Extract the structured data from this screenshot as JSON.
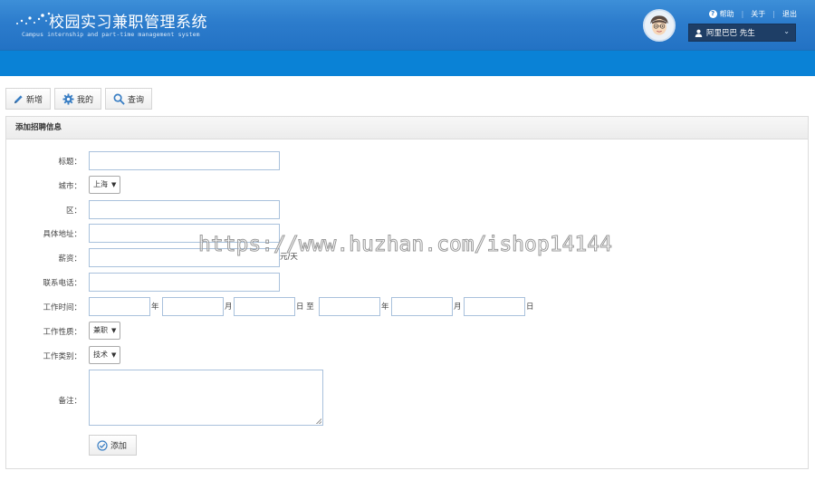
{
  "header": {
    "title": "校园实习兼职管理系统",
    "subtitle": "Campus internship and part-time management system",
    "links": {
      "help": "帮助",
      "about": "关于",
      "logout": "退出"
    },
    "user": "阿里巴巴 先生",
    "user_dropdown_icon": "chevron-down-icon"
  },
  "toolbar": {
    "new_label": "新增",
    "mine_label": "我的",
    "query_label": "查询"
  },
  "panel": {
    "title": "添加招聘信息"
  },
  "form": {
    "title_label": "标题：",
    "city_label": "城市：",
    "city_value": "上海",
    "district_label": "区：",
    "address_label": "具体地址：",
    "salary_label": "薪资：",
    "salary_unit": "元/天",
    "phone_label": "联系电话：",
    "worktime_label": "工作时间：",
    "year": "年",
    "month": "月",
    "day_to": "日 至",
    "day": "日",
    "nature_label": "工作性质：",
    "nature_value": "兼职",
    "category_label": "工作类别：",
    "category_value": "技术",
    "remark_label": "备注：",
    "submit_label": "添加"
  },
  "watermark": "https://www.huzhan.com/ishop14144",
  "colors": {
    "header_blue": "#2c7ccc",
    "nav_blue": "#0a82d6",
    "user_box": "#1e3e66"
  }
}
